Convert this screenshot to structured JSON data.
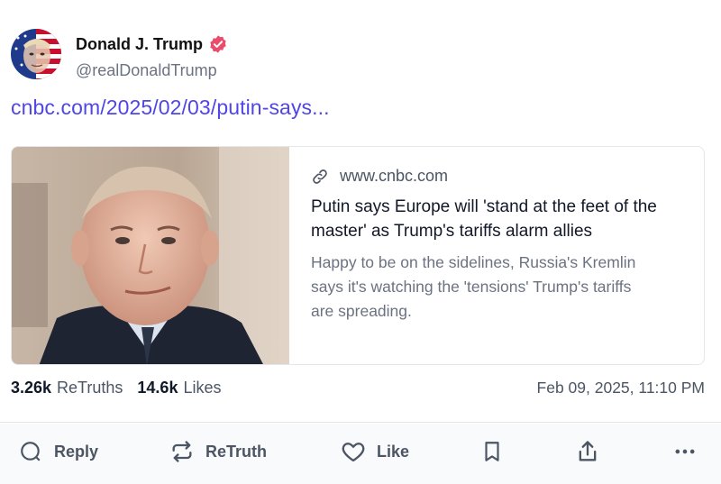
{
  "author": {
    "display_name": "Donald J. Trump",
    "handle": "@realDonaldTrump",
    "verified_color": "#ea4c6c"
  },
  "post": {
    "link_text": "cnbc.com/2025/02/03/putin-says..."
  },
  "card": {
    "domain": "www.cnbc.com",
    "title": "Putin says Europe will 'stand at the feet of the master' as Trump's tariffs alarm allies",
    "description": "Happy to be on the sidelines, Russia's Kremlin says it's watching the 'tensions' Trump's tariffs are spreading."
  },
  "stats": {
    "retruths_count": "3.26k",
    "retruths_label": "ReTruths",
    "likes_count": "14.6k",
    "likes_label": "Likes",
    "timestamp": "Feb 09, 2025, 11:10 PM"
  },
  "actions": {
    "reply_label": "Reply",
    "retruth_label": "ReTruth",
    "like_label": "Like"
  },
  "colors": {
    "link": "#4f46e5",
    "text": "#111827",
    "muted": "#6b7280",
    "action": "#4b5563"
  },
  "icons": [
    "verified-badge-icon",
    "link-icon",
    "reply-icon",
    "retruth-icon",
    "heart-icon",
    "bookmark-icon",
    "share-icon",
    "more-icon"
  ]
}
